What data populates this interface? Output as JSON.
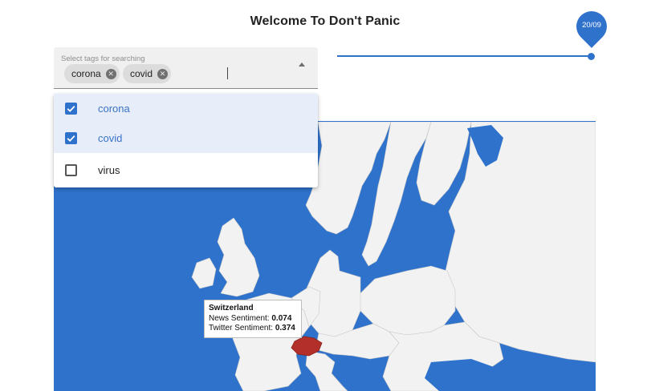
{
  "header": {
    "title": "Welcome To Don't Panic"
  },
  "slider": {
    "value_label": "20/09",
    "value_fraction": 1.0
  },
  "tag_select": {
    "label": "Select tags for searching",
    "chips": [
      {
        "label": "corona"
      },
      {
        "label": "covid"
      }
    ],
    "options": [
      {
        "label": "corona",
        "checked": true
      },
      {
        "label": "covid",
        "checked": true
      },
      {
        "label": "virus",
        "checked": false
      }
    ]
  },
  "map": {
    "water_color": "#2f72cc",
    "land_color": "#f2f2f2",
    "highlight_color": "#b3302a",
    "tooltip": {
      "country": "Switzerland",
      "news_label": "News Sentiment:",
      "news_value": "0.074",
      "twitter_label": "Twitter Sentiment:",
      "twitter_value": "0.374"
    }
  },
  "icons": {
    "chip_remove": "close-circle-icon",
    "dropdown_arrow": "arrow-up-icon",
    "checkbox": "checkbox-icon"
  }
}
